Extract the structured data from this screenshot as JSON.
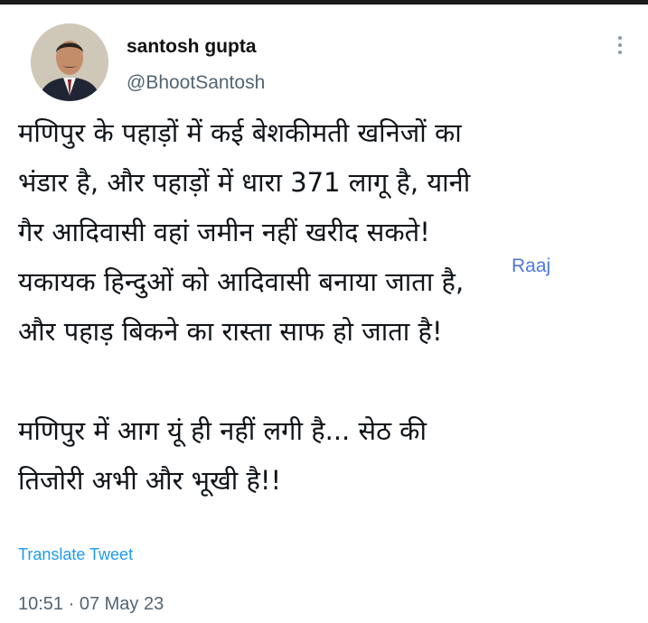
{
  "tweet": {
    "author_name": "santosh gupta",
    "author_handle": "@BhootSantosh",
    "lines": [
      "मणिपुर के पहाड़ों में कई बेशकीमती खनिजों का",
      "भंडार है, और पहाड़ों में धारा 371 लागू है, यानी",
      "गैर आदिवासी वहां जमीन नहीं खरीद सकते!",
      "यकायक हिन्दुओं को आदिवासी बनाया जाता है,",
      "और पहाड़ बिकने का रास्ता साफ हो जाता है!"
    ],
    "lines2": [
      "मणिपुर में आग यूं ही नहीं लगी है... सेठ की",
      "तिजोरी अभी और भूखी है!!"
    ],
    "watermark": "Raaj",
    "translate_label": "Translate Tweet",
    "timestamp": "10:51 · 07 May 23"
  },
  "icons": {
    "more": "more-options-icon",
    "avatar": "profile-avatar"
  },
  "colors": {
    "link": "#1d9bf0",
    "secondary_text": "#536471",
    "primary_text": "#0f1419"
  }
}
